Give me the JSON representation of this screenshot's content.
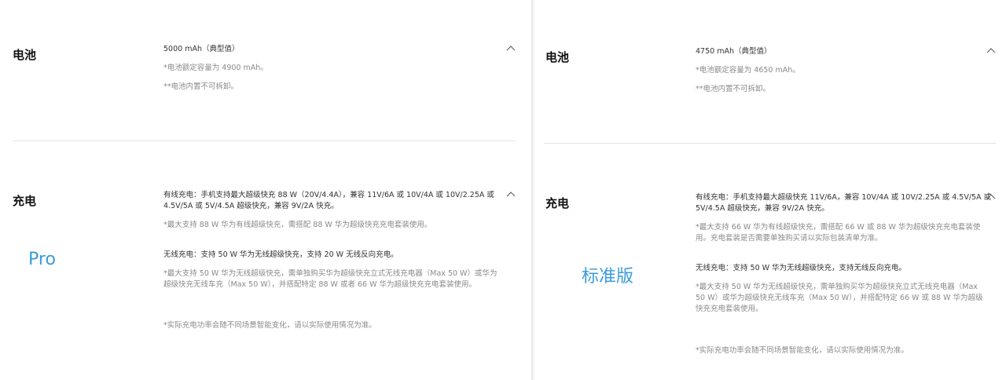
{
  "left": {
    "battery": {
      "title": "电池",
      "capacity": "5000 mAh（典型值）",
      "notes": [
        "*电池额定容量为 4900 mAh。",
        "**电池内置不可拆卸。"
      ]
    },
    "charging": {
      "title": "充电",
      "wired": [
        "有线充电：手机支持最大超级快充 88 W（20V/4.4A），兼容 11V/6A 或 10V/4A 或 10V/2.25A 或",
        "4.5V/5A 或 5V/4.5A 超级快充，兼容 9V/2A 快充。"
      ],
      "wired_note": "*最大支持 88 W 华为有线超级快充，需搭配 88 W 华为超级快充充电套装使用。",
      "wireless": "无线充电：支持 50 W 华为无线超级快充，支持 20 W 无线反向充电。",
      "wireless_note": [
        "*最大支持 50 W 华为无线超级快充，需单独购买华为超级快充立式无线充电器（Max 50 W）或华为",
        "超级快充无线车充（Max 50 W），并搭配特定 88 W 或者 66 W 华为超级快充充电套装使用。"
      ],
      "footnote": "*实际充电功率会随不同场景智能变化，请以实际使用情况为准。"
    },
    "model_label": "Pro"
  },
  "right": {
    "battery": {
      "title": "电池",
      "capacity": "4750 mAh（典型值）",
      "notes": [
        "*电池额定容量为 4650 mAh。",
        "**电池内置不可拆卸。"
      ]
    },
    "charging": {
      "title": "充电",
      "wired": [
        "有线充电：手机支持最大超级快充 11V/6A，兼容 10V/4A 或 10V/2.25A 或 4.5V/5A 或",
        "5V/4.5A 超级快充，兼容 9V/2A 快充。"
      ],
      "wired_note": [
        "*最大支持 66 W 华为有线超级快充，需搭配 66 W 或 88 W 华为超级快充充电套装使",
        "用。充电套装是否需要单独购买请以实际包装清单为准。"
      ],
      "wireless": "无线充电：支持 50 W 华为无线超级快充，支持无线反向充电。",
      "wireless_note": [
        "*最大支持 50 W 华为无线超级快充，需单独购买华为超级快充立式无线充电器（Max",
        "50 W）或华为超级快充无线车充（Max 50 W），并搭配特定 66 W 或 88 W 华为超级",
        "快充充电套装使用。"
      ],
      "footnote": "*实际充电功率会随不同场景智能变化，请以实际使用情况为准。"
    },
    "model_label": "标准版"
  },
  "colors": {
    "accent": "#3a9bd9",
    "text": "#333333",
    "note": "#8a8a8a",
    "divider": "#e3e3e3"
  },
  "icons": {
    "collapse": "chevron-up-icon"
  }
}
